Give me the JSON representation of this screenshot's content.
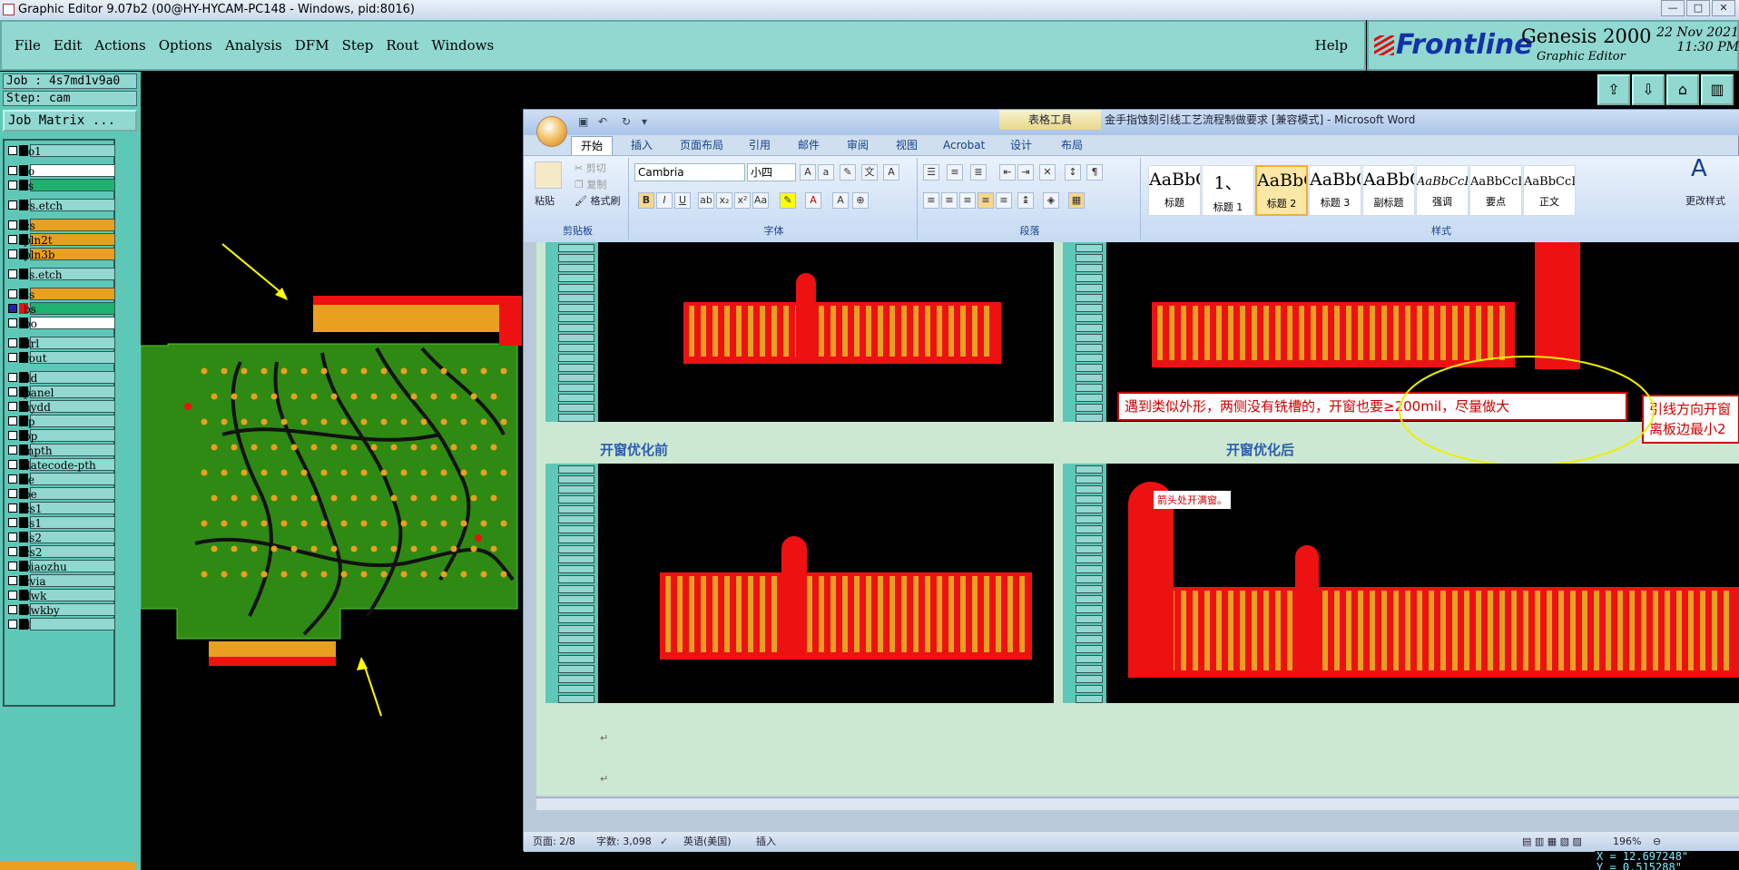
{
  "titlebar": {
    "title": "Graphic Editor 9.07b2 (00@HY-HYCAM-PC148 - Windows, pid:8016)"
  },
  "menu": {
    "items": [
      "File",
      "Edit",
      "Actions",
      "Options",
      "Analysis",
      "DFM",
      "Step",
      "Rout",
      "Windows"
    ],
    "help": "Help"
  },
  "brand": {
    "logo": "Frontline",
    "product": "Genesis 2000",
    "subtitle": "Graphic Editor",
    "date": "22 Nov 2021",
    "time": "11:30 PM"
  },
  "job": {
    "job": "Job : 4s7md1v9a0",
    "step": "Step: cam",
    "matrix": "Job Matrix ..."
  },
  "layers": [
    {
      "name": "to1",
      "color": "#90d8d0"
    },
    {
      "name": "to",
      "color": "#ffffff"
    },
    {
      "name": "ts",
      "color": "#20b070"
    },
    {
      "name": "cs.etch",
      "color": "#90d8d0"
    },
    {
      "name": "cs",
      "color": "#e8a020"
    },
    {
      "name": "pln2t",
      "color": "#e8a020"
    },
    {
      "name": "pln3b",
      "color": "#e8a020"
    },
    {
      "name": "ss.etch",
      "color": "#90d8d0"
    },
    {
      "name": "ss",
      "color": "#e8a020"
    },
    {
      "name": "bs",
      "color": "#20b070"
    },
    {
      "name": "bo",
      "color": "#ffffff"
    },
    {
      "name": "drl",
      "color": "#90d8d0"
    },
    {
      "name": "rout",
      "color": "#90d8d0"
    },
    {
      "name": "dd",
      "color": "#90d8d0"
    },
    {
      "name": "panel",
      "color": "#90d8d0"
    },
    {
      "name": "hydd",
      "color": "#90d8d0"
    },
    {
      "name": "tp",
      "color": "#90d8d0"
    },
    {
      "name": "bp",
      "color": "#90d8d0"
    },
    {
      "name": "mpth",
      "color": "#90d8d0"
    },
    {
      "name": "datecode-pth",
      "color": "#90d8d0"
    },
    {
      "name": "te",
      "color": "#90d8d0"
    },
    {
      "name": "be",
      "color": "#90d8d0"
    },
    {
      "name": "cs1",
      "color": "#90d8d0"
    },
    {
      "name": "ss1",
      "color": "#90d8d0"
    },
    {
      "name": "ss2",
      "color": "#90d8d0"
    },
    {
      "name": "cs2",
      "color": "#90d8d0"
    },
    {
      "name": "biaozhu",
      "color": "#90d8d0"
    },
    {
      "name": "cvia",
      "color": "#90d8d0"
    },
    {
      "name": "dwk",
      "color": "#90d8d0"
    },
    {
      "name": "dwkby",
      "color": "#90d8d0"
    },
    {
      "name": "d",
      "color": "#90d8d0"
    }
  ],
  "word": {
    "context_tab": "表格工具",
    "title": "金手指蚀刻引线工艺流程制做要求 [兼容模式] - Microsoft Word",
    "tabs": [
      "开始",
      "插入",
      "页面布局",
      "引用",
      "邮件",
      "审阅",
      "视图",
      "Acrobat",
      "设计",
      "布局"
    ],
    "clipboard": {
      "label": "剪贴板",
      "paste": "粘贴",
      "cut": "剪切",
      "copy": "复制",
      "format_painter": "格式刷"
    },
    "font": {
      "label": "字体",
      "name": "Cambria",
      "size": "小四"
    },
    "paragraph": {
      "label": "段落"
    },
    "styles": {
      "label": "样式",
      "change": "更改样式",
      "items": [
        {
          "preview": "AaBbC",
          "name": "标题"
        },
        {
          "preview": "1、",
          "name": "标题 1"
        },
        {
          "preview": "AaBbC",
          "name": "标题 2"
        },
        {
          "preview": "AaBbC",
          "name": "标题 3"
        },
        {
          "preview": "AaBbC",
          "name": "副标题"
        },
        {
          "preview": "AaBbCcDd",
          "name": "强调"
        },
        {
          "preview": "AaBbCcD",
          "name": "要点"
        },
        {
          "preview": "AaBbCcDd",
          "name": "正文"
        }
      ]
    },
    "doc": {
      "callout1": "遇到类似外形，两侧没有铣槽的，开窗也要≥200mil，尽量做大",
      "callout2a": "引线方向开窗",
      "callout2b": "离板边最小2",
      "caption_before": "开窗优化前",
      "caption_after": "开窗优化后",
      "inner_note": "箭头处开满窗。"
    },
    "status": {
      "page": "页面: 2/8",
      "words": "字数: 3,098",
      "lang": "英语(美国)",
      "mode": "插入",
      "zoom": "196%"
    }
  },
  "coords": {
    "x": "X = 12.697248\"",
    "y": "Y =  0.515288\""
  }
}
